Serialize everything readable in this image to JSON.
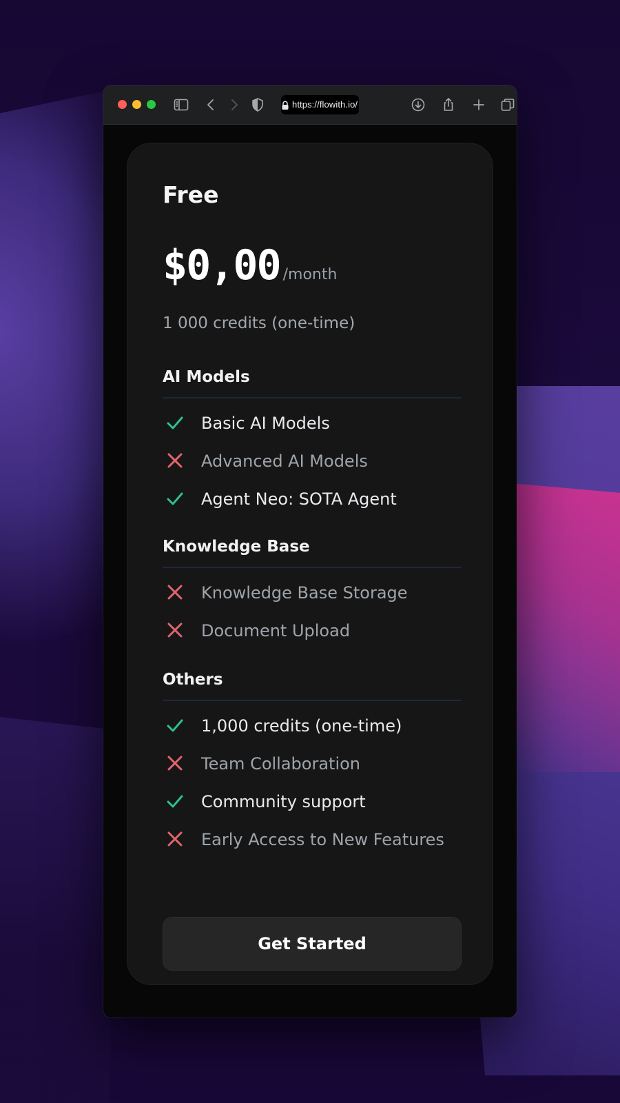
{
  "browser": {
    "url": "https://flowith.io/"
  },
  "plan": {
    "name": "Free",
    "price": "$0,00",
    "period": "/month",
    "credits_summary": "1 000 credits (one-time)"
  },
  "sections": [
    {
      "title": "AI Models",
      "features": [
        {
          "label": "Basic AI Models",
          "included": true
        },
        {
          "label": "Advanced AI Models",
          "included": false
        },
        {
          "label": "Agent Neo: SOTA Agent",
          "included": true
        }
      ]
    },
    {
      "title": "Knowledge Base",
      "features": [
        {
          "label": "Knowledge Base Storage",
          "included": false
        },
        {
          "label": "Document Upload",
          "included": false
        }
      ]
    },
    {
      "title": "Others",
      "features": [
        {
          "label": "1,000 credits (one-time)",
          "included": true
        },
        {
          "label": "Team Collaboration",
          "included": false
        },
        {
          "label": "Community support",
          "included": true
        },
        {
          "label": "Early Access to New Features",
          "included": false
        }
      ]
    }
  ],
  "cta": {
    "label": "Get Started"
  },
  "colors": {
    "check": "#2fbf8f",
    "cross": "#e0656c",
    "card_bg": "#161616",
    "button_bg": "#262626"
  },
  "icons": {
    "included": "check-icon",
    "excluded": "cross-icon"
  }
}
